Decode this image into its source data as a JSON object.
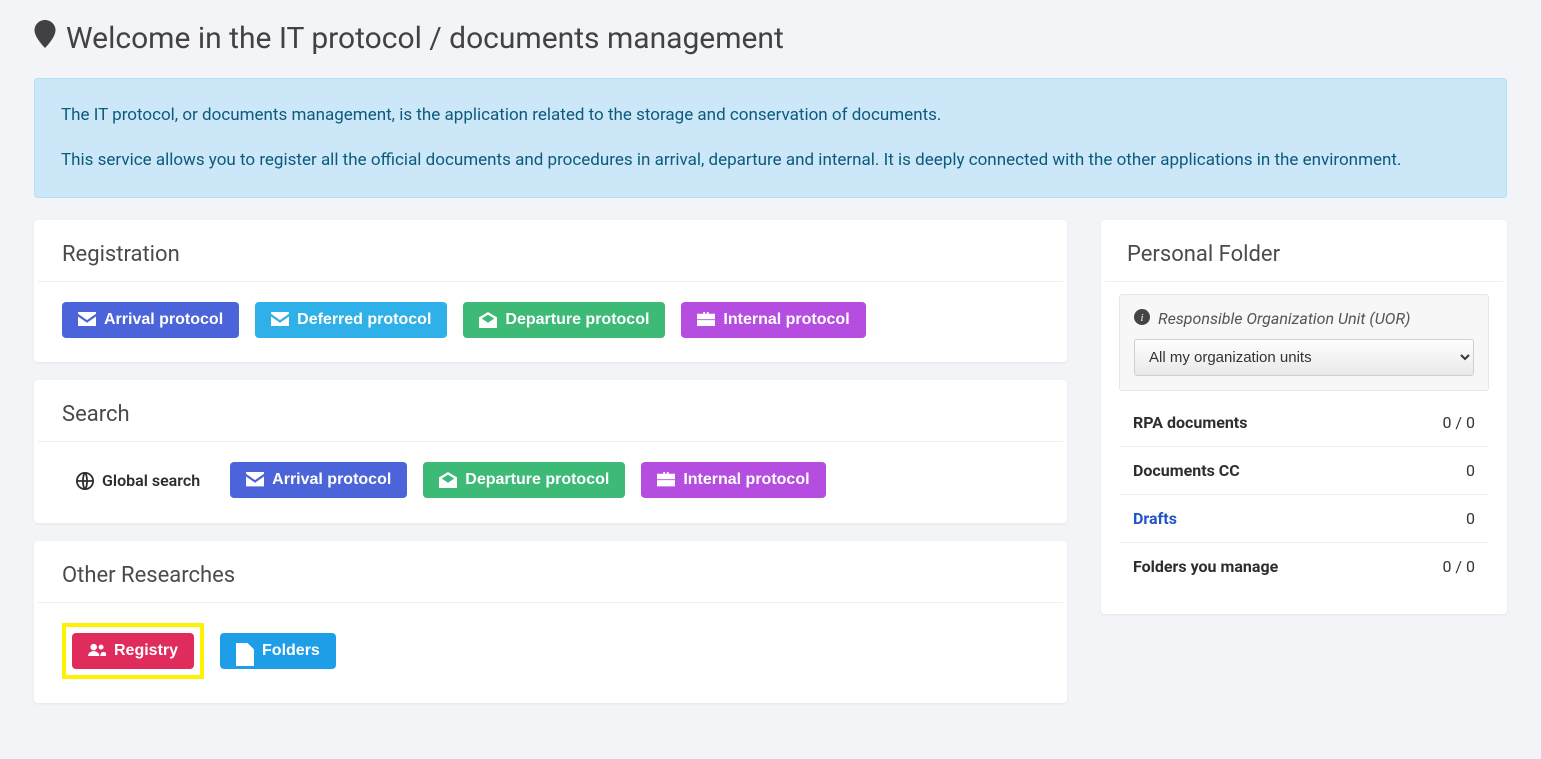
{
  "page": {
    "title": "Welcome in the IT protocol / documents management"
  },
  "banner": {
    "line1": "The IT protocol, or documents management, is the application related to the storage and conservation of documents.",
    "line2": "This service allows you to register all the official documents and procedures in arrival, departure and internal. It is deeply connected with the other applications in the environment."
  },
  "sections": {
    "registration": {
      "title": "Registration",
      "buttons": {
        "arrival": "Arrival protocol",
        "deferred": "Deferred protocol",
        "departure": "Departure protocol",
        "internal": "Internal protocol"
      }
    },
    "search": {
      "title": "Search",
      "global": "Global search",
      "buttons": {
        "arrival": "Arrival protocol",
        "departure": "Departure protocol",
        "internal": "Internal protocol"
      }
    },
    "other": {
      "title": "Other Researches",
      "buttons": {
        "registry": "Registry",
        "folders": "Folders"
      }
    }
  },
  "sidebar": {
    "title": "Personal Folder",
    "uor_label": "Responsible Organization Unit (UOR)",
    "uor_selected": "All my organization units",
    "stats": {
      "rpa": {
        "label": "RPA documents",
        "value": "0 / 0"
      },
      "cc": {
        "label": "Documents CC",
        "value": "0"
      },
      "drafts": {
        "label": "Drafts",
        "value": "0"
      },
      "folders": {
        "label": "Folders you manage",
        "value": "0 / 0"
      }
    }
  }
}
